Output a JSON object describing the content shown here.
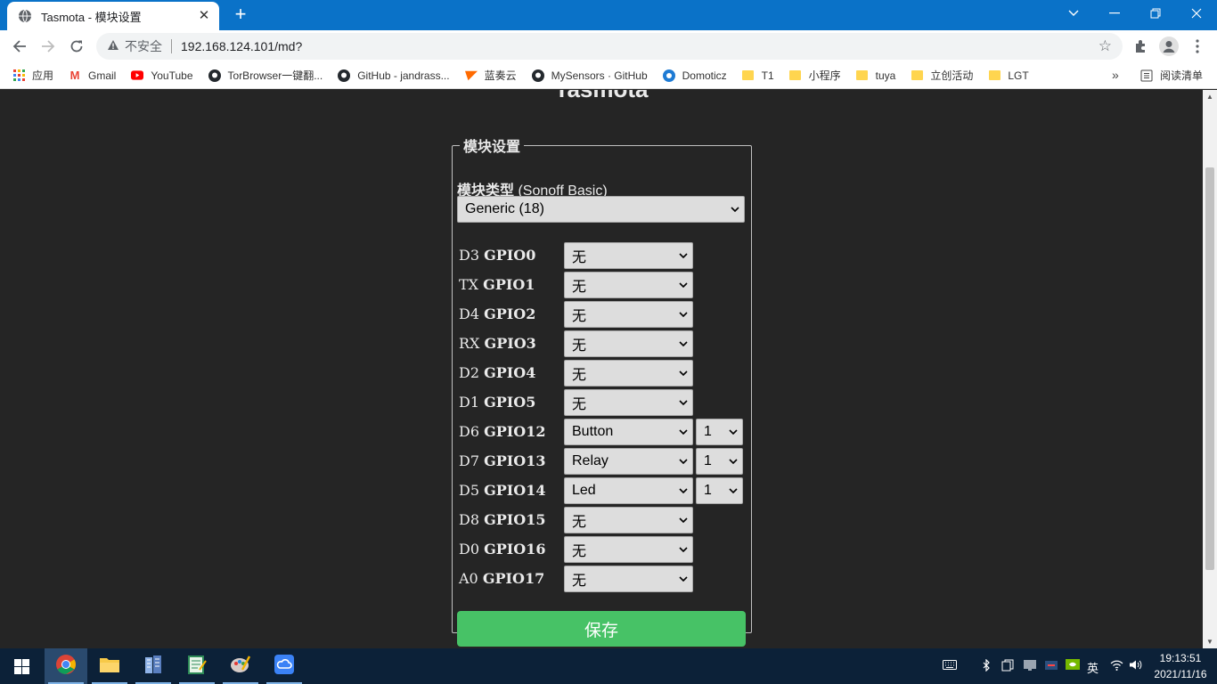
{
  "browser": {
    "tab_title": "Tasmota - 模块设置",
    "tab_close": "✕",
    "new_tab": "+",
    "omnibox_security": "不安全",
    "omnibox_url": "192.168.124.101/md?",
    "bookmarks": [
      {
        "label": "应用",
        "icon": "apps-grid-icon"
      },
      {
        "label": "Gmail",
        "icon": "gmail-icon"
      },
      {
        "label": "YouTube",
        "icon": "youtube-icon"
      },
      {
        "label": "TorBrowser一键翻...",
        "icon": "github-icon"
      },
      {
        "label": "GitHub - jandrass...",
        "icon": "github-icon"
      },
      {
        "label": "蓝奏云",
        "icon": "lanzou-icon"
      },
      {
        "label": "MySensors · GitHub",
        "icon": "github-icon"
      },
      {
        "label": "Domoticz",
        "icon": "domoticz-icon"
      },
      {
        "label": "T1",
        "icon": "folder-icon"
      },
      {
        "label": "小程序",
        "icon": "folder-icon"
      },
      {
        "label": "tuya",
        "icon": "folder-icon"
      },
      {
        "label": "立创活动",
        "icon": "folder-icon"
      },
      {
        "label": "LGT",
        "icon": "folder-icon"
      }
    ],
    "more_bookmarks": "»",
    "reading_list": "阅读清单"
  },
  "page": {
    "brand": "Tasmota",
    "legend": "模块设置",
    "module_type_label": "模块类型",
    "module_type_current": "(Sonoff Basic)",
    "module_type_selected": "Generic (18)",
    "gpios": [
      {
        "pin": "D3",
        "gpio": "GPIO0",
        "value": "无"
      },
      {
        "pin": "TX",
        "gpio": "GPIO1",
        "value": "无"
      },
      {
        "pin": "D4",
        "gpio": "GPIO2",
        "value": "无"
      },
      {
        "pin": "RX",
        "gpio": "GPIO3",
        "value": "无"
      },
      {
        "pin": "D2",
        "gpio": "GPIO4",
        "value": "无"
      },
      {
        "pin": "D1",
        "gpio": "GPIO5",
        "value": "无"
      },
      {
        "pin": "D6",
        "gpio": "GPIO12",
        "value": "Button",
        "index": "1"
      },
      {
        "pin": "D7",
        "gpio": "GPIO13",
        "value": "Relay",
        "index": "1"
      },
      {
        "pin": "D5",
        "gpio": "GPIO14",
        "value": "Led",
        "index": "1"
      },
      {
        "pin": "D8",
        "gpio": "GPIO15",
        "value": "无"
      },
      {
        "pin": "D0",
        "gpio": "GPIO16",
        "value": "无"
      },
      {
        "pin": "A0",
        "gpio": "GPIO17",
        "value": "无"
      }
    ],
    "save_label": "保存"
  },
  "taskbar": {
    "time": "19:13:51",
    "date": "2021/11/16",
    "ime": "英"
  },
  "colors": {
    "chrome_blue": "#0a72c8",
    "page_bg": "#252525",
    "save_green": "#47c266",
    "taskbar": "#0c2138"
  }
}
